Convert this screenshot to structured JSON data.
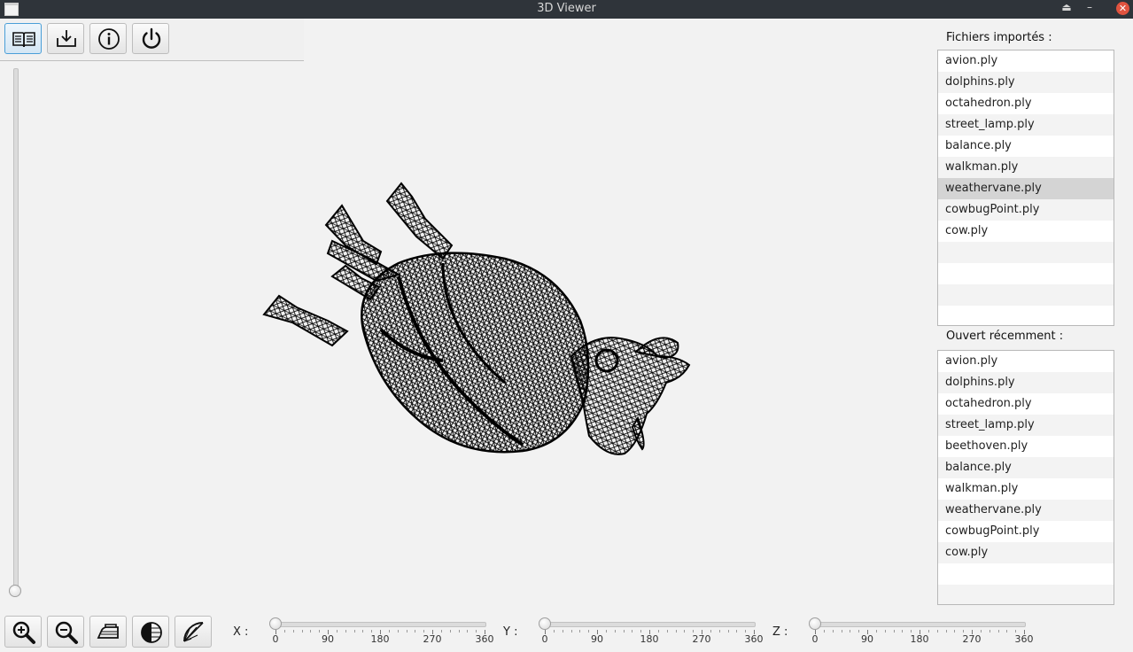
{
  "window": {
    "title": "3D Viewer"
  },
  "toolbar": {
    "buttons": [
      {
        "name": "library-button",
        "icon": "open-book-icon",
        "active": true
      },
      {
        "name": "import-button",
        "icon": "download-tray-icon"
      },
      {
        "name": "info-button",
        "icon": "info-circle-icon"
      },
      {
        "name": "power-button",
        "icon": "power-icon"
      }
    ]
  },
  "imported": {
    "label": "Fichiers importés :",
    "files": [
      "avion.ply",
      "dolphins.ply",
      "octahedron.ply",
      "street_lamp.ply",
      "balance.ply",
      "walkman.ply",
      "weathervane.ply",
      "cowbugPoint.ply",
      "cow.ply"
    ],
    "selected": "weathervane.ply"
  },
  "recent": {
    "label": "Ouvert récemment  :",
    "files": [
      "avion.ply",
      "dolphins.ply",
      "octahedron.ply",
      "street_lamp.ply",
      "beethoven.ply",
      "balance.ply",
      "walkman.ply",
      "weathervane.ply",
      "cowbugPoint.ply",
      "cow.ply"
    ]
  },
  "bottom_tools": [
    {
      "name": "zoom-in-button",
      "icon": "zoom-in-icon"
    },
    {
      "name": "zoom-out-button",
      "icon": "zoom-out-icon"
    },
    {
      "name": "iron-button",
      "icon": "iron-icon"
    },
    {
      "name": "shading-button",
      "icon": "half-sphere-icon"
    },
    {
      "name": "slice-button",
      "icon": "citrus-slice-icon"
    }
  ],
  "rotation": {
    "x": {
      "label": "X :",
      "value": 0
    },
    "y": {
      "label": "Y :",
      "value": 0
    },
    "z": {
      "label": "Z :",
      "value": 0
    },
    "min": 0,
    "max": 360,
    "tick_labels": [
      "0",
      "90",
      "180",
      "270",
      "360"
    ]
  },
  "zoom_slider": {
    "value": 0
  },
  "colors": {
    "titlebar": "#2f343a",
    "close": "#e0533f",
    "selection": "#d4d4d4",
    "mesh": "#000000"
  }
}
